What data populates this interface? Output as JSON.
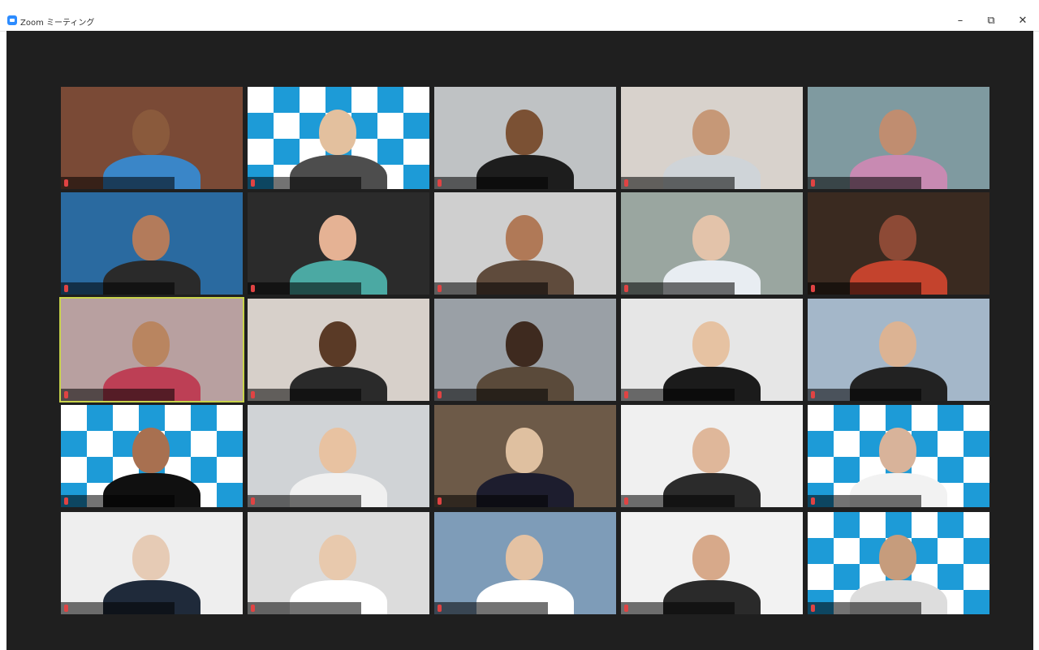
{
  "window": {
    "title": "Zoom ミーティング",
    "minimize": "–",
    "restore": "⧉",
    "close": "✕"
  },
  "colors": {
    "meeting_bg": "#1f1f1f",
    "active_speaker_border": "#c8d34a",
    "zoom_blue": "#2d8cff"
  },
  "tiles": [
    {
      "bg": "#7a4a36",
      "skin": "#8a5a3c",
      "shirt": "#3a86c8",
      "name": ""
    },
    {
      "bg": "pattern",
      "skin": "#e3c09e",
      "shirt": "#4d4d4d",
      "name": ""
    },
    {
      "bg": "#bfc2c4",
      "skin": "#7b5134",
      "shirt": "#1d1d1d",
      "name": ""
    },
    {
      "bg": "#d8d2cc",
      "skin": "#c69877",
      "shirt": "#cfd4d8",
      "name": ""
    },
    {
      "bg": "#7f9aa0",
      "skin": "#c08d70",
      "shirt": "#c88ab2",
      "name": ""
    },
    {
      "bg": "#2a6aa0",
      "skin": "#b37b5b",
      "shirt": "#2a2a2a",
      "name": ""
    },
    {
      "bg": "#2b2b2b",
      "skin": "#e5b294",
      "shirt": "#4ba9a3",
      "name": ""
    },
    {
      "bg": "#cfcfcf",
      "skin": "#b07957",
      "shirt": "#5f4b3c",
      "name": ""
    },
    {
      "bg": "#9aa6a0",
      "skin": "#e3c3aa",
      "shirt": "#e8edf2",
      "name": ""
    },
    {
      "bg": "#3a2a20",
      "skin": "#8d4a36",
      "shirt": "#c4432d",
      "name": ""
    },
    {
      "bg": "#b8a0a0",
      "skin": "#b98560",
      "shirt": "#bd3f55",
      "name": "",
      "active": true
    },
    {
      "bg": "#d7d0ca",
      "skin": "#5a3a26",
      "shirt": "#2a2a2a",
      "name": ""
    },
    {
      "bg": "#9aa0a6",
      "skin": "#3e2a1f",
      "shirt": "#5a4a3a",
      "name": ""
    },
    {
      "bg": "#e6e6e6",
      "skin": "#e6c2a2",
      "shirt": "#1b1b1b",
      "name": ""
    },
    {
      "bg": "#a4b7c9",
      "skin": "#dcb393",
      "shirt": "#222222",
      "name": ""
    },
    {
      "bg": "pattern",
      "skin": "#a87050",
      "shirt": "#101010",
      "name": ""
    },
    {
      "bg": "#d0d3d6",
      "skin": "#e8c2a1",
      "shirt": "#f0f0f0",
      "name": ""
    },
    {
      "bg": "#6d5a48",
      "skin": "#dfc0a0",
      "shirt": "#1d1d2e",
      "name": ""
    },
    {
      "bg": "#f0f0f0",
      "skin": "#dfb79a",
      "shirt": "#2b2b2b",
      "name": ""
    },
    {
      "bg": "pattern",
      "skin": "#d8b39a",
      "shirt": "#f2f2f2",
      "name": ""
    },
    {
      "bg": "#eeeeee",
      "skin": "#e6cbb5",
      "shirt": "#1f2a3a",
      "name": ""
    },
    {
      "bg": "#dcdcdc",
      "skin": "#e8c9ad",
      "shirt": "#ffffff",
      "name": ""
    },
    {
      "bg": "#7e9cb8",
      "skin": "#e4c2a3",
      "shirt": "#ffffff",
      "name": ""
    },
    {
      "bg": "#f2f2f2",
      "skin": "#d7a98a",
      "shirt": "#2a2a2a",
      "name": ""
    },
    {
      "bg": "pattern",
      "skin": "#c69c7c",
      "shirt": "#dddddd",
      "name": ""
    }
  ]
}
